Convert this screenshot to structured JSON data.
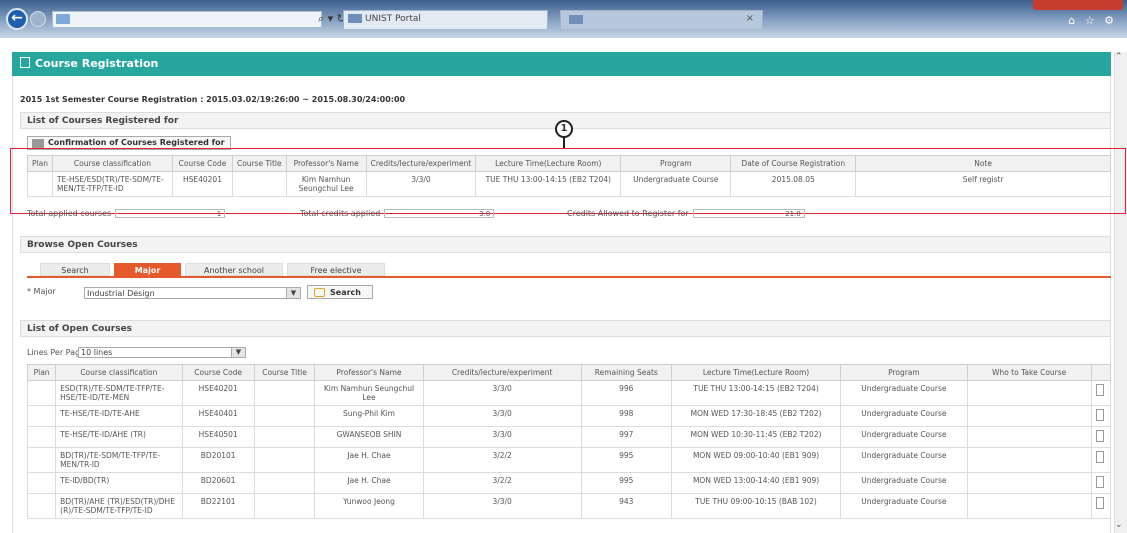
{
  "browser": {
    "back_glyph": "←",
    "tools": "⌕ ▾ ↻",
    "tab_title": "UNIST Portal",
    "tab_close": "×",
    "right_icons": "⌂ ☆ ⚙"
  },
  "page": {
    "title": "Course Registration",
    "semester_info": "2015 1st Semester  Course Registration : 2015.03.02/19:26:00  ~  2015.08.30/24:00:00"
  },
  "registered": {
    "section_title": "List of Courses Registered for",
    "confirm_label": "Confirmation of Courses Registered for",
    "marker": "1",
    "columns": [
      "Plan",
      "Course classification",
      "Course Code",
      "Course Title",
      "Professor's Name",
      "Credits/lecture/experiment",
      "Lecture Time(Lecture Room)",
      "Program",
      "Date of Course Registration",
      "Note"
    ],
    "rows": [
      [
        "",
        "TE-HSE/ESD(TR)/TE-SDM/TE-MEN/TE-TFP/TE-ID",
        "HSE40201",
        "",
        "Kim Namhun Seungchul Lee",
        "3/3/0",
        "TUE THU 13:00-14:15 (EB2 T204)",
        "Undergraduate Course",
        "2015.08.05",
        "Self registr"
      ]
    ],
    "summary": {
      "applied_label": "Total applied courses",
      "applied_value": "1",
      "credits_label": "Total credits applied",
      "credits_value": "3.0",
      "allowed_label": "Credits Allowed to Register for",
      "allowed_value": "21.0"
    }
  },
  "browse": {
    "section_title": "Browse Open Courses",
    "tabs": [
      "Search",
      "Major",
      "Another school",
      "Free elective"
    ],
    "active_tab": "Major",
    "major_label": "* Major",
    "major_value": "Industrial Design",
    "search_label": "Search"
  },
  "open_courses": {
    "section_title": "List of Open Courses",
    "lines_label": "Lines Per Page",
    "lines_value": "10 lines",
    "columns": [
      "Plan",
      "Course classification",
      "Course Code",
      "Course Title",
      "Professor's Name",
      "Credits/lecture/experiment",
      "Remaining Seats",
      "Lecture Time(Lecture Room)",
      "Program",
      "Who to Take Course"
    ],
    "rows": [
      [
        "",
        "ESD(TR)/TE-SDM/TE-TFP/TE-HSE/TE-ID/TE-MEN",
        "HSE40201",
        "",
        "Kim Namhun Seungchul Lee",
        "3/3/0",
        "996",
        "TUE THU 13:00-14:15 (EB2 T204)",
        "Undergraduate Course",
        ""
      ],
      [
        "",
        "TE-HSE/TE-ID/TE-AHE",
        "HSE40401",
        "",
        "Sung-Phil Kim",
        "3/3/0",
        "998",
        "MON WED 17:30-18:45 (EB2 T202)",
        "Undergraduate Course",
        ""
      ],
      [
        "",
        "TE-HSE/TE-ID/AHE (TR)",
        "HSE40501",
        "",
        "GWANSEOB SHIN",
        "3/3/0",
        "997",
        "MON WED 10:30-11:45 (EB2 T202)",
        "Undergraduate Course",
        ""
      ],
      [
        "",
        "BD(TR)/TE-SDM/TE-TFP/TE-MEN/TR-ID",
        "BD20101",
        "",
        "Jae H. Chae",
        "3/2/2",
        "995",
        "MON WED 09:00-10:40 (EB1 909)",
        "Undergraduate Course",
        ""
      ],
      [
        "",
        "TE-ID/BD(TR)",
        "BD20601",
        "",
        "Jae H. Chae",
        "3/2/2",
        "995",
        "MON WED 13:00-14:40 (EB1 909)",
        "Undergraduate Course",
        ""
      ],
      [
        "",
        "BD(TR)/AHE (TR)/ESD(TR)/DHE (R)/TE-SDM/TE-TFP/TE-ID",
        "BD22101",
        "",
        "Yunwoo Jeong",
        "3/3/0",
        "943",
        "TUE THU 09:00-10:15 (BAB 102)",
        "Undergraduate Course",
        ""
      ]
    ]
  }
}
